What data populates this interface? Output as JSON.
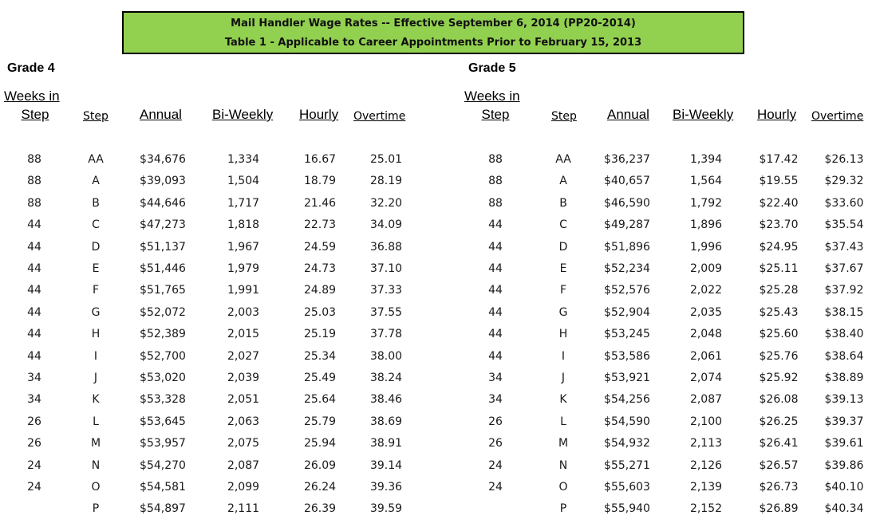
{
  "banner": {
    "line1": "Mail Handler Wage Rates -- Effective September 6, 2014 (PP20-2014)",
    "line2": "Table 1 - Applicable to Career Appointments Prior to February 15, 2013",
    "background_color": "#92d050"
  },
  "tables": [
    {
      "title": "Grade 4",
      "headers": {
        "weeks_line1": "Weeks in ",
        "weeks_line2": "Step",
        "step": "Step",
        "annual": "Annual",
        "biweekly": "Bi-Weekly",
        "hourly": "Hourly",
        "overtime": "Overtime"
      },
      "rows": [
        {
          "weeks": "88",
          "step": "AA",
          "annual": "$34,676",
          "biweekly": "1,334",
          "hourly": "16.67",
          "overtime": "25.01"
        },
        {
          "weeks": "88",
          "step": "A",
          "annual": "$39,093",
          "biweekly": "1,504",
          "hourly": "18.79",
          "overtime": "28.19"
        },
        {
          "weeks": "88",
          "step": "B",
          "annual": "$44,646",
          "biweekly": "1,717",
          "hourly": "21.46",
          "overtime": "32.20"
        },
        {
          "weeks": "44",
          "step": "C",
          "annual": "$47,273",
          "biweekly": "1,818",
          "hourly": "22.73",
          "overtime": "34.09"
        },
        {
          "weeks": "44",
          "step": "D",
          "annual": "$51,137",
          "biweekly": "1,967",
          "hourly": "24.59",
          "overtime": "36.88"
        },
        {
          "weeks": "44",
          "step": "E",
          "annual": "$51,446",
          "biweekly": "1,979",
          "hourly": "24.73",
          "overtime": "37.10"
        },
        {
          "weeks": "44",
          "step": "F",
          "annual": "$51,765",
          "biweekly": "1,991",
          "hourly": "24.89",
          "overtime": "37.33"
        },
        {
          "weeks": "44",
          "step": "G",
          "annual": "$52,072",
          "biweekly": "2,003",
          "hourly": "25.03",
          "overtime": "37.55"
        },
        {
          "weeks": "44",
          "step": "H",
          "annual": "$52,389",
          "biweekly": "2,015",
          "hourly": "25.19",
          "overtime": "37.78"
        },
        {
          "weeks": "44",
          "step": "I",
          "annual": "$52,700",
          "biweekly": "2,027",
          "hourly": "25.34",
          "overtime": "38.00"
        },
        {
          "weeks": "34",
          "step": "J",
          "annual": "$53,020",
          "biweekly": "2,039",
          "hourly": "25.49",
          "overtime": "38.24"
        },
        {
          "weeks": "34",
          "step": "K",
          "annual": "$53,328",
          "biweekly": "2,051",
          "hourly": "25.64",
          "overtime": "38.46"
        },
        {
          "weeks": "26",
          "step": "L",
          "annual": "$53,645",
          "biweekly": "2,063",
          "hourly": "25.79",
          "overtime": "38.69"
        },
        {
          "weeks": "26",
          "step": "M",
          "annual": "$53,957",
          "biweekly": "2,075",
          "hourly": "25.94",
          "overtime": "38.91"
        },
        {
          "weeks": "24",
          "step": "N",
          "annual": "$54,270",
          "biweekly": "2,087",
          "hourly": "26.09",
          "overtime": "39.14"
        },
        {
          "weeks": "24",
          "step": "O",
          "annual": "$54,581",
          "biweekly": "2,099",
          "hourly": "26.24",
          "overtime": "39.36"
        },
        {
          "weeks": "",
          "step": "P",
          "annual": "$54,897",
          "biweekly": "2,111",
          "hourly": "26.39",
          "overtime": "39.59"
        }
      ]
    },
    {
      "title": "Grade 5",
      "headers": {
        "weeks_line1": "Weeks in ",
        "weeks_line2": "Step",
        "step": "Step",
        "annual": "Annual",
        "biweekly": "Bi-Weekly",
        "hourly": "Hourly",
        "overtime": "Overtime"
      },
      "rows": [
        {
          "weeks": "88",
          "step": "AA",
          "annual": "$36,237",
          "biweekly": "1,394",
          "hourly": "$17.42",
          "overtime": "$26.13"
        },
        {
          "weeks": "88",
          "step": "A",
          "annual": "$40,657",
          "biweekly": "1,564",
          "hourly": "$19.55",
          "overtime": "$29.32"
        },
        {
          "weeks": "88",
          "step": "B",
          "annual": "$46,590",
          "biweekly": "1,792",
          "hourly": "$22.40",
          "overtime": "$33.60"
        },
        {
          "weeks": "44",
          "step": "C",
          "annual": "$49,287",
          "biweekly": "1,896",
          "hourly": "$23.70",
          "overtime": "$35.54"
        },
        {
          "weeks": "44",
          "step": "D",
          "annual": "$51,896",
          "biweekly": "1,996",
          "hourly": "$24.95",
          "overtime": "$37.43"
        },
        {
          "weeks": "44",
          "step": "E",
          "annual": "$52,234",
          "biweekly": "2,009",
          "hourly": "$25.11",
          "overtime": "$37.67"
        },
        {
          "weeks": "44",
          "step": "F",
          "annual": "$52,576",
          "biweekly": "2,022",
          "hourly": "$25.28",
          "overtime": "$37.92"
        },
        {
          "weeks": "44",
          "step": "G",
          "annual": "$52,904",
          "biweekly": "2,035",
          "hourly": "$25.43",
          "overtime": "$38.15"
        },
        {
          "weeks": "44",
          "step": "H",
          "annual": "$53,245",
          "biweekly": "2,048",
          "hourly": "$25.60",
          "overtime": "$38.40"
        },
        {
          "weeks": "44",
          "step": "I",
          "annual": "$53,586",
          "biweekly": "2,061",
          "hourly": "$25.76",
          "overtime": "$38.64"
        },
        {
          "weeks": "34",
          "step": "J",
          "annual": "$53,921",
          "biweekly": "2,074",
          "hourly": "$25.92",
          "overtime": "$38.89"
        },
        {
          "weeks": "34",
          "step": "K",
          "annual": "$54,256",
          "biweekly": "2,087",
          "hourly": "$26.08",
          "overtime": "$39.13"
        },
        {
          "weeks": "26",
          "step": "L",
          "annual": "$54,590",
          "biweekly": "2,100",
          "hourly": "$26.25",
          "overtime": "$39.37"
        },
        {
          "weeks": "26",
          "step": "M",
          "annual": "$54,932",
          "biweekly": "2,113",
          "hourly": "$26.41",
          "overtime": "$39.61"
        },
        {
          "weeks": "24",
          "step": "N",
          "annual": "$55,271",
          "biweekly": "2,126",
          "hourly": "$26.57",
          "overtime": "$39.86"
        },
        {
          "weeks": "24",
          "step": "O",
          "annual": "$55,603",
          "biweekly": "2,139",
          "hourly": "$26.73",
          "overtime": "$40.10"
        },
        {
          "weeks": "",
          "step": "P",
          "annual": "$55,940",
          "biweekly": "2,152",
          "hourly": "$26.89",
          "overtime": "$40.34"
        }
      ]
    }
  ]
}
